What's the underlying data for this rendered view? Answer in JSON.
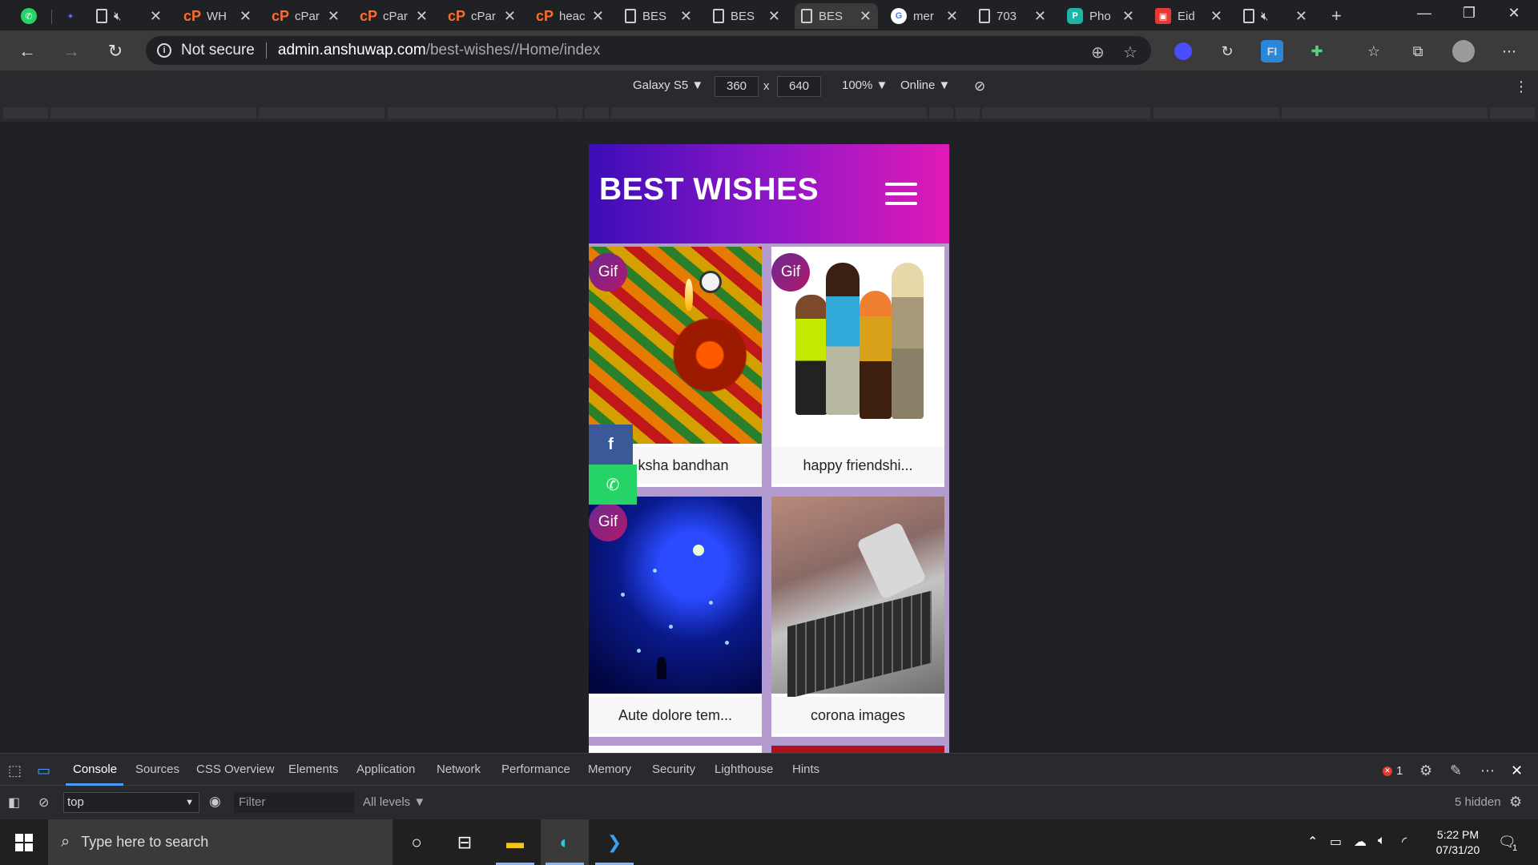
{
  "browser": {
    "tabs": [
      {
        "favicon": "whatsapp-icon",
        "title": ""
      },
      {
        "favicon": "logo-icon",
        "title": ""
      },
      {
        "favicon": "page-icon",
        "title": "",
        "muted": true
      },
      {
        "favicon": "cpanel-icon",
        "title": "WH"
      },
      {
        "favicon": "cpanel-icon",
        "title": "cPar"
      },
      {
        "favicon": "cpanel-icon",
        "title": "cPar"
      },
      {
        "favicon": "cpanel-icon",
        "title": "cPar"
      },
      {
        "favicon": "cpanel-icon",
        "title": "heac"
      },
      {
        "favicon": "page-icon",
        "title": "BES"
      },
      {
        "favicon": "page-icon",
        "title": "BES"
      },
      {
        "favicon": "page-icon",
        "title": "BES",
        "active": true
      },
      {
        "favicon": "google-icon",
        "title": "mer"
      },
      {
        "favicon": "page-icon",
        "title": "703"
      },
      {
        "favicon": "photo-icon",
        "title": "Pho"
      },
      {
        "favicon": "gift-icon",
        "title": "Eid"
      },
      {
        "favicon": "page-icon",
        "title": "",
        "muted": true
      }
    ],
    "new_tab_symbol": "+",
    "window_controls": {
      "minimize": "—",
      "restore": "❐",
      "close": "✕"
    },
    "address": {
      "security_label": "Not secure",
      "url_host": "admin.anshuwap.com",
      "url_path": "/best-wishes//Home/index"
    },
    "nav_symbols": {
      "back": "←",
      "forward": "→",
      "reload": "↻",
      "more": "⋯"
    }
  },
  "device_toolbar": {
    "device": "Galaxy S5 ▼",
    "width": "360",
    "times": "x",
    "height": "640",
    "zoom": "100% ▼",
    "network": "Online ▼",
    "more": "⋮"
  },
  "site": {
    "title": "BEST WISHES",
    "cards": [
      {
        "title": "raksha bandhan",
        "display_title": "ksha bandhan",
        "gif": true,
        "image": "diya"
      },
      {
        "title": "happy friendshi...",
        "gif": true,
        "image": "friends"
      },
      {
        "title": "Aute dolore tem...",
        "gif": true,
        "image": "night"
      },
      {
        "title": "corona images",
        "gif": false,
        "image": "laptop"
      }
    ],
    "gif_badge": "Gif",
    "share": {
      "facebook_glyph": "f",
      "whatsapp_glyph": "✆"
    }
  },
  "devtools": {
    "tabs": [
      "Console",
      "Sources",
      "CSS Overview",
      "Elements",
      "Application",
      "Network",
      "Performance",
      "Memory",
      "Security",
      "Lighthouse",
      "Hints"
    ],
    "active_tab": "Console",
    "error_count": "1",
    "context": "top",
    "context_arrow": "▼",
    "filter_placeholder": "Filter",
    "levels": "All levels ▼",
    "hidden": "5 hidden"
  },
  "taskbar": {
    "search_placeholder": "Type here to search",
    "time": "5:22 PM",
    "date": "07/31/20",
    "notification_count": "1"
  }
}
